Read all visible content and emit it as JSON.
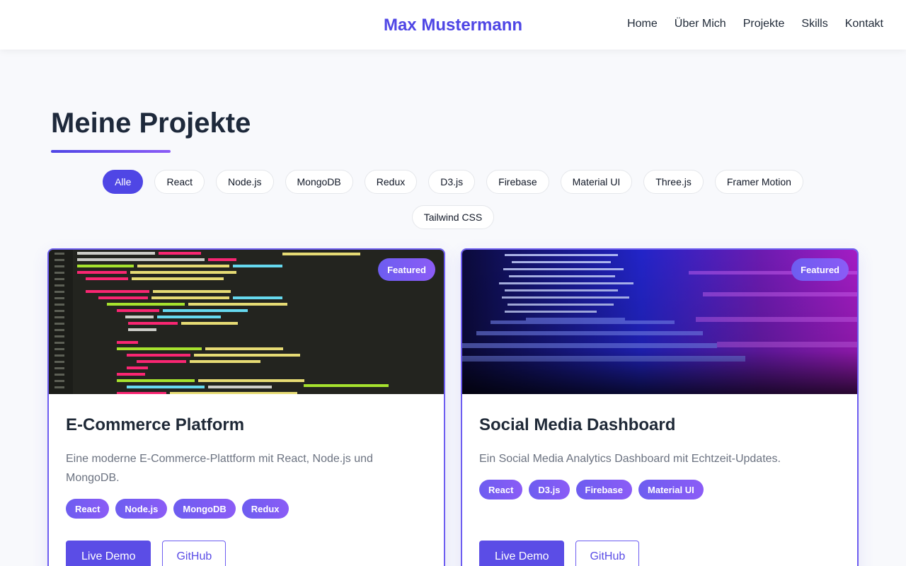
{
  "header": {
    "brand": "Max Mustermann",
    "nav": [
      "Home",
      "Über Mich",
      "Projekte",
      "Skills",
      "Kontakt"
    ]
  },
  "main": {
    "title": "Meine Projekte",
    "filters": [
      "Alle",
      "React",
      "Node.js",
      "MongoDB",
      "Redux",
      "D3.js",
      "Firebase",
      "Material UI",
      "Three.js",
      "Framer Motion",
      "Tailwind CSS"
    ],
    "active_filter": "Alle",
    "projects": [
      {
        "badge": "Featured",
        "title": "E-Commerce Platform",
        "description": "Eine moderne E-Commerce-Plattform mit React, Node.js und MongoDB.",
        "tags": [
          "React",
          "Node.js",
          "MongoDB",
          "Redux"
        ],
        "demo_label": "Live Demo",
        "github_label": "GitHub"
      },
      {
        "badge": "Featured",
        "title": "Social Media Dashboard",
        "description": "Ein Social Media Analytics Dashboard mit Echtzeit-Updates.",
        "tags": [
          "React",
          "D3.js",
          "Firebase",
          "Material UI"
        ],
        "demo_label": "Live Demo",
        "github_label": "GitHub"
      }
    ]
  },
  "colors": {
    "accent": "#4f46e5",
    "accent_gradient_end": "#8b5cf6",
    "text_dark": "#1f2937",
    "text_muted": "#6b7280"
  }
}
